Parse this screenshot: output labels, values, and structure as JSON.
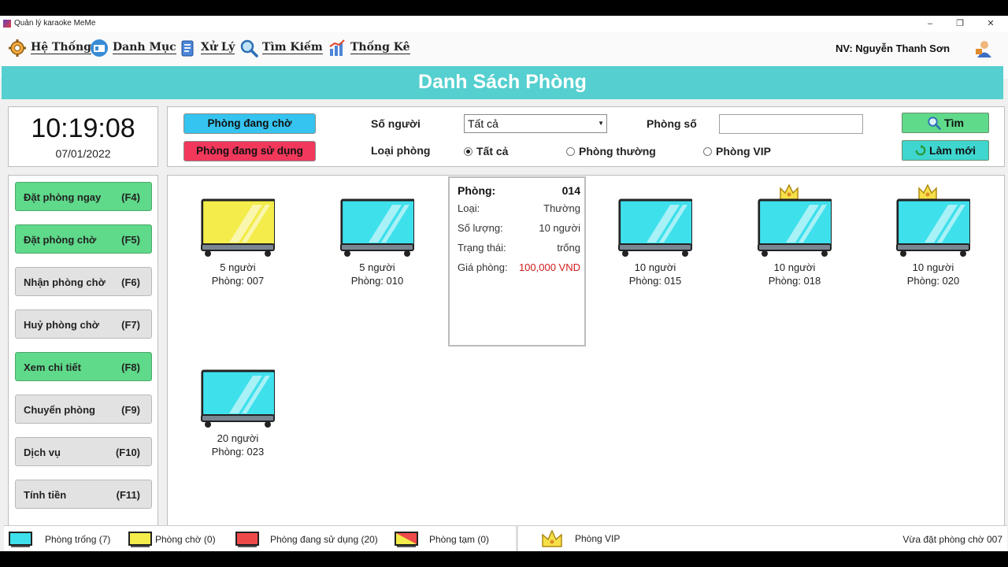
{
  "window": {
    "title": "Quản lý karaoke MeMe",
    "minimize": "–",
    "maximize": "❐",
    "close": "✕"
  },
  "menu": [
    {
      "label": "Hệ Thống",
      "icon": "gear-icon"
    },
    {
      "label": "Danh Mục",
      "icon": "catalog-icon"
    },
    {
      "label": "Xử Lý",
      "icon": "clipboard-icon"
    },
    {
      "label": "Tìm Kiếm",
      "icon": "search-icon"
    },
    {
      "label": "Thống Kê",
      "icon": "bar-chart-icon"
    }
  ],
  "staff": "NV: Nguyễn Thanh Sơn",
  "header_title": "Danh Sách Phòng",
  "clock": {
    "time": "10:19:08",
    "date": "07/01/2022"
  },
  "filters": {
    "waiting_label": "Phòng đang chờ",
    "in_use_label": "Phòng đang sử dụng",
    "people_label": "Số người",
    "people_value": "Tất cả",
    "room_no_label": "Phòng số",
    "room_no_value": "",
    "type_label": "Loại phòng",
    "type_all": "Tất cả",
    "type_normal": "Phòng thường",
    "type_vip": "Phòng VIP",
    "selected_type": "all",
    "search_btn": "Tìm",
    "refresh_btn": "Làm mới",
    "waiting_color": "#35c4ef",
    "in_use_color": "#f2385b"
  },
  "actions": [
    {
      "label": "Đặt phòng ngay",
      "key": "(F4)",
      "active": true
    },
    {
      "label": "Đặt phòng chờ",
      "key": "(F5)",
      "active": true
    },
    {
      "label": "Nhận phòng chờ",
      "key": "(F6)",
      "active": false
    },
    {
      "label": "Huỷ phòng chờ",
      "key": "(F7)",
      "active": false
    },
    {
      "label": "Xem chi tiết",
      "key": "(F8)",
      "active": true
    },
    {
      "label": "Chuyển phòng",
      "key": "(F9)",
      "active": false
    },
    {
      "label": "Dịch vụ",
      "key": "(F10)",
      "active": false
    },
    {
      "label": "Tính tiền",
      "key": "(F11)",
      "active": false
    }
  ],
  "rooms": [
    {
      "people": "5 người",
      "room": "Phòng: 007",
      "status": "waiting",
      "vip": false
    },
    {
      "people": "5 người",
      "room": "Phòng: 010",
      "status": "empty",
      "vip": false
    },
    {
      "people": "10 người",
      "room": "Phòng: 015",
      "status": "empty",
      "vip": false
    },
    {
      "people": "10 người",
      "room": "Phòng: 018",
      "status": "empty",
      "vip": true
    },
    {
      "people": "10 người",
      "room": "Phòng: 020",
      "status": "empty",
      "vip": true
    },
    {
      "people": "20 người",
      "room": "Phòng: 023",
      "status": "empty",
      "vip": false
    }
  ],
  "popup": {
    "room_label": "Phòng:",
    "room_value": "014",
    "type_label": "Loại:",
    "type_value": "Thường",
    "capacity_label": "Số lượng:",
    "capacity_value": "10 người",
    "status_label": "Trạng thái:",
    "status_value": "trống",
    "price_label": "Giá phòng:",
    "price_value": "100,000 VND",
    "price_color": "#d01a1a"
  },
  "legend": {
    "empty": "Phòng trống (7)",
    "waiting": "Phòng chờ (0)",
    "in_use": "Phòng đang sử dụng (20)",
    "temp": "Phòng tạm (0)",
    "vip": "Phòng VIP"
  },
  "status_message": "Vừa đặt phòng chờ 007",
  "colors": {
    "empty_screen": "#3ee0ec",
    "waiting_screen": "#f3ec4a",
    "in_use_screen": "#ef4a4a",
    "header": "#55cfcf",
    "green_button": "#5fd98a"
  }
}
